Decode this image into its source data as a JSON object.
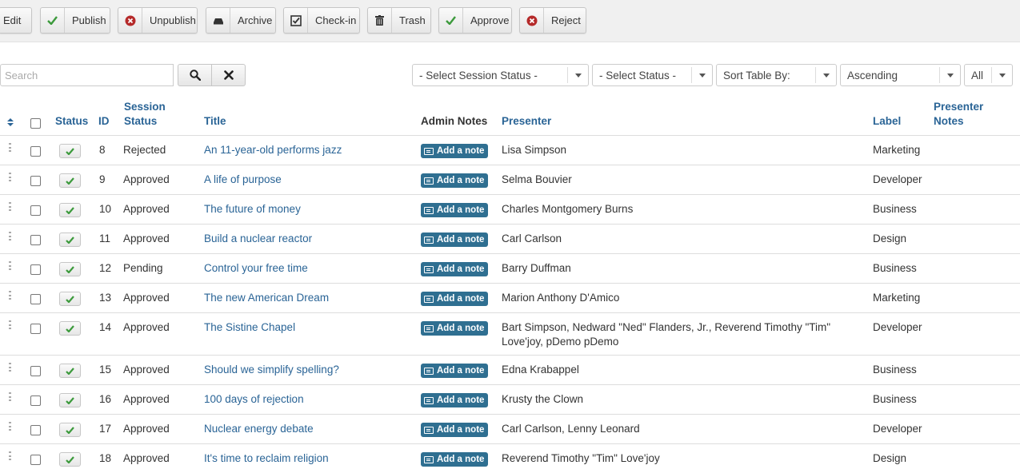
{
  "toolbar": {
    "edit": "Edit",
    "publish": "Publish",
    "unpublish": "Unpublish",
    "archive": "Archive",
    "checkin": "Check-in",
    "trash": "Trash",
    "approve": "Approve",
    "reject": "Reject"
  },
  "filters": {
    "search_placeholder": "Search",
    "session_status": "- Select Session Status -",
    "status": "- Select Status -",
    "sort_by": "Sort Table By:",
    "direction": "Ascending",
    "limit": "All"
  },
  "table": {
    "headers": {
      "status": "Status",
      "id": "ID",
      "session_status_1": "Session",
      "session_status_2": "Status",
      "title": "Title",
      "admin_notes": "Admin Notes",
      "presenter": "Presenter",
      "label": "Label",
      "presenter_notes_1": "Presenter",
      "presenter_notes_2": "Notes"
    },
    "note_button_label": "Add a note",
    "rows": [
      {
        "id": "8",
        "session_status": "Rejected",
        "title": "An 11-year-old performs jazz",
        "presenter": "Lisa Simpson",
        "presenter_2": "",
        "label": "Marketing"
      },
      {
        "id": "9",
        "session_status": "Approved",
        "title": "A life of purpose",
        "presenter": "Selma Bouvier",
        "presenter_2": "",
        "label": "Developer"
      },
      {
        "id": "10",
        "session_status": "Approved",
        "title": "The future of money",
        "presenter": "Charles Montgomery Burns",
        "presenter_2": "",
        "label": "Business"
      },
      {
        "id": "11",
        "session_status": "Approved",
        "title": "Build a nuclear reactor",
        "presenter": "Carl Carlson",
        "presenter_2": "",
        "label": "Design"
      },
      {
        "id": "12",
        "session_status": "Pending",
        "title": "Control your free time",
        "presenter": "Barry Duffman",
        "presenter_2": "",
        "label": "Business"
      },
      {
        "id": "13",
        "session_status": "Approved",
        "title": "The new American Dream",
        "presenter": "Marion Anthony D'Amico",
        "presenter_2": "",
        "label": "Marketing"
      },
      {
        "id": "14",
        "session_status": "Approved",
        "title": "The Sistine Chapel",
        "presenter": "Bart Simpson, Nedward \"Ned\" Flanders, Jr., Reverend Timothy \"Tim\"",
        "presenter_2": "Love'joy, pDemo pDemo",
        "label": "Developer"
      },
      {
        "id": "15",
        "session_status": "Approved",
        "title": "Should we simplify spelling?",
        "presenter": "Edna Krabappel",
        "presenter_2": "",
        "label": "Business"
      },
      {
        "id": "16",
        "session_status": "Approved",
        "title": "100 days of rejection",
        "presenter": "Krusty the Clown",
        "presenter_2": "",
        "label": "Business"
      },
      {
        "id": "17",
        "session_status": "Approved",
        "title": "Nuclear energy debate",
        "presenter": "Carl Carlson, Lenny Leonard",
        "presenter_2": "",
        "label": "Developer"
      },
      {
        "id": "18",
        "session_status": "Approved",
        "title": "It's time to reclaim religion",
        "presenter": "Reverend Timothy \"Tim\" Love'joy",
        "presenter_2": "",
        "label": "Design"
      }
    ]
  },
  "colors": {
    "link": "#2a6496",
    "check_green": "#3c9a3c",
    "reject_red": "#b52a2a",
    "note_button": "#2f6f91"
  }
}
